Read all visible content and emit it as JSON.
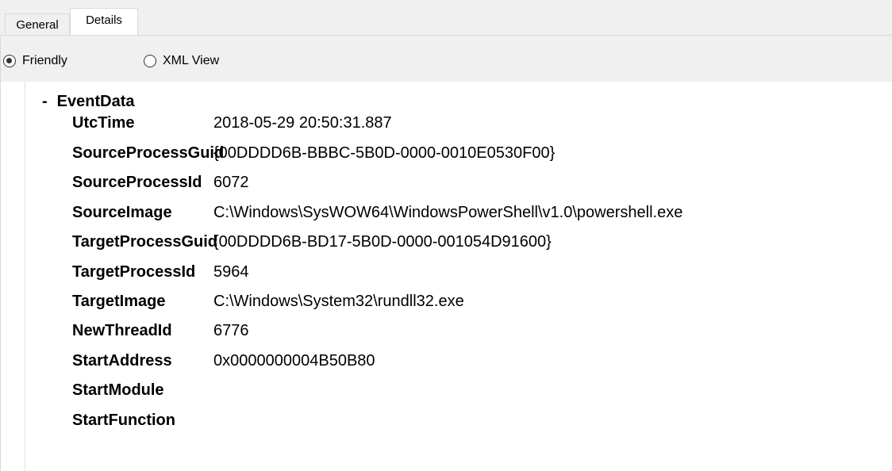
{
  "tabs": {
    "general_label": "General",
    "details_label": "Details"
  },
  "view_mode": {
    "friendly_label": "Friendly",
    "xml_label": "XML View",
    "selected": "Friendly"
  },
  "event_data": {
    "toggle": "-",
    "title": "EventData",
    "fields": [
      {
        "key": "UtcTime",
        "value": "2018-05-29 20:50:31.887"
      },
      {
        "key": "SourceProcessGuid",
        "value": "{00DDDD6B-BBBC-5B0D-0000-0010E0530F00}"
      },
      {
        "key": "SourceProcessId",
        "value": "6072"
      },
      {
        "key": "SourceImage",
        "value": "C:\\Windows\\SysWOW64\\WindowsPowerShell\\v1.0\\powershell.exe"
      },
      {
        "key": "TargetProcessGuid",
        "value": "{00DDDD6B-BD17-5B0D-0000-001054D91600}"
      },
      {
        "key": "TargetProcessId",
        "value": "5964"
      },
      {
        "key": "TargetImage",
        "value": "C:\\Windows\\System32\\rundll32.exe"
      },
      {
        "key": "NewThreadId",
        "value": "6776"
      },
      {
        "key": "StartAddress",
        "value": "0x0000000004B50B80"
      },
      {
        "key": "StartModule",
        "value": ""
      },
      {
        "key": "StartFunction",
        "value": ""
      }
    ]
  }
}
